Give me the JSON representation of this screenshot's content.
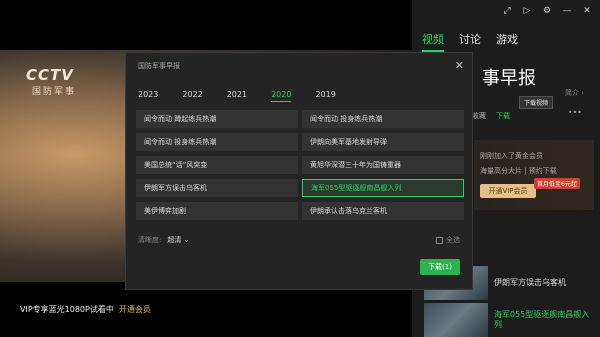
{
  "player": {
    "logo": "CCTV",
    "logo_sub": "国防军事",
    "vip_message": "VIP专享蓝光1080P试看中",
    "vip_link": "开通会员"
  },
  "panel": {
    "icons": [
      "expand-icon",
      "cast-icon",
      "settings-icon",
      "minimize-icon",
      "close-icon"
    ],
    "tabs": [
      {
        "label": "视频",
        "active": true
      },
      {
        "label": "讨论",
        "active": false
      },
      {
        "label": "游戏",
        "active": false
      }
    ],
    "title": "事早报",
    "intro": "简介",
    "tooltip": "下载视频",
    "favorite_label": "收藏",
    "download_label": "下载",
    "more_glyph": "•••",
    "vip_line1": "刚刚加入了黄金会员",
    "vip_line2": "海量高分大片 | 预约下载",
    "vip_button": "开通VIP会员",
    "vip_badge": "首月低至6元起",
    "episodes": [
      {
        "title": "伊朗军方误击乌客机",
        "active": false
      },
      {
        "title": "海军055型驱逐舰南昌舰入列",
        "active": true
      }
    ]
  },
  "modal": {
    "title": "国防军事早报",
    "years": [
      "2023",
      "2022",
      "2021",
      "2020",
      "2019"
    ],
    "active_year": "2020",
    "items": [
      {
        "label": "闻令而动 蹲起练兵热潮",
        "selected": false
      },
      {
        "label": "闻令而动 投身练兵热潮",
        "selected": false
      },
      {
        "label": "闻令而动 投身练兵热潮",
        "selected": false
      },
      {
        "label": "伊朗向美军基地发射导弹",
        "selected": false
      },
      {
        "label": "美国总统“话”风突变",
        "selected": false
      },
      {
        "label": "黄旭华深潜三十年为国铸重器",
        "selected": false
      },
      {
        "label": "伊朗军方误击乌客机",
        "selected": false
      },
      {
        "label": "海军055型驱逐舰南昌舰入列",
        "selected": true
      },
      {
        "label": "美伊博弈加剧",
        "selected": false
      },
      {
        "label": "伊朗承认击落乌克兰客机",
        "selected": false
      }
    ],
    "quality_label": "清晰度:",
    "quality_value": "超清",
    "select_all": "全选",
    "download_button": "下载(1)"
  },
  "colors": {
    "accent": "#2ed15f",
    "vip_gold": "#e6c08a"
  }
}
